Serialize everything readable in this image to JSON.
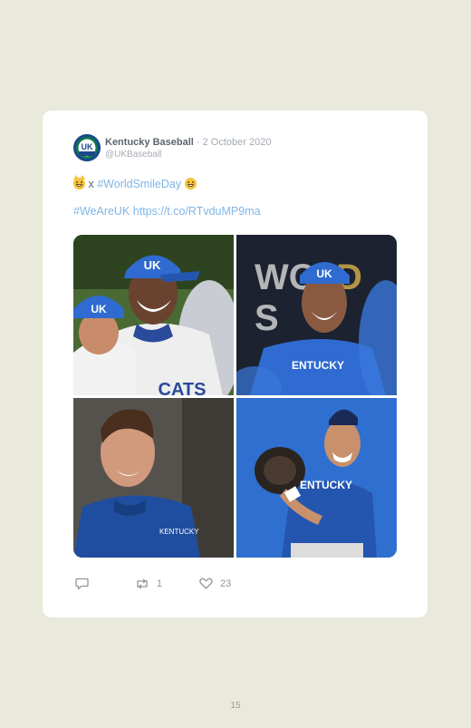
{
  "tweet": {
    "author_name": "Kentucky Baseball",
    "date": "· 2 October 2020",
    "handle": "@UKBaseball",
    "line1_sep": "x",
    "line1_hashtag": "#WorldSmileDay",
    "line2_hashtag": "#WeAreUK",
    "line2_url": "https://t.co/RTvduMP9ma",
    "replies": "",
    "retweets": "1",
    "likes": "23",
    "avatar_text": "UK",
    "link_color": "#7fb6e6"
  },
  "page": {
    "number": "15"
  },
  "icons": [
    "baseball-logo-icon",
    "smiling-cat-emoji-icon",
    "grinning-emoji-icon",
    "reply-icon",
    "retweet-icon",
    "like-icon"
  ]
}
